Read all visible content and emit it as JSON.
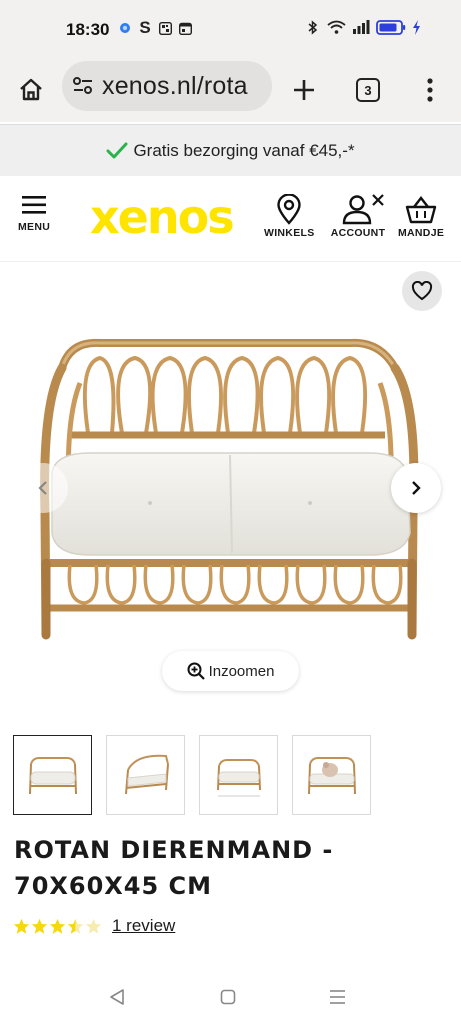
{
  "status_bar": {
    "time": "18:30",
    "left_icons": [
      "meta-icon",
      "s-icon",
      "qr-icon",
      "calendar-icon"
    ],
    "right_icons": [
      "bluetooth-icon",
      "wifi-icon",
      "signal-icon",
      "battery-icon",
      "charging-icon"
    ]
  },
  "browser": {
    "url": "xenos.nl/rota",
    "tab_count": "3"
  },
  "promo": {
    "text": "Gratis bezorging vanaf €45,-*",
    "check_color": "#2bb24c"
  },
  "header": {
    "logo": "xenos",
    "logo_color": "#ffe400",
    "menu_label": "MENU",
    "stores_label": "WINKELS",
    "account_label": "ACCOUNT",
    "cart_label": "MANDJE"
  },
  "gallery": {
    "zoom_label": "Inzoomen",
    "thumbnails": [
      "product-front",
      "product-side",
      "product-front-dims",
      "product-with-dog"
    ],
    "active_thumbnail": 0
  },
  "product": {
    "title": "ROTAN DIERENMAND - 70X60X45 CM",
    "rating": 3.5,
    "rating_max": 5,
    "star_color": "#f5d90a",
    "review_link": "1 review"
  },
  "nav_bar": {
    "icons": [
      "back-icon",
      "home-icon",
      "recents-icon"
    ]
  }
}
